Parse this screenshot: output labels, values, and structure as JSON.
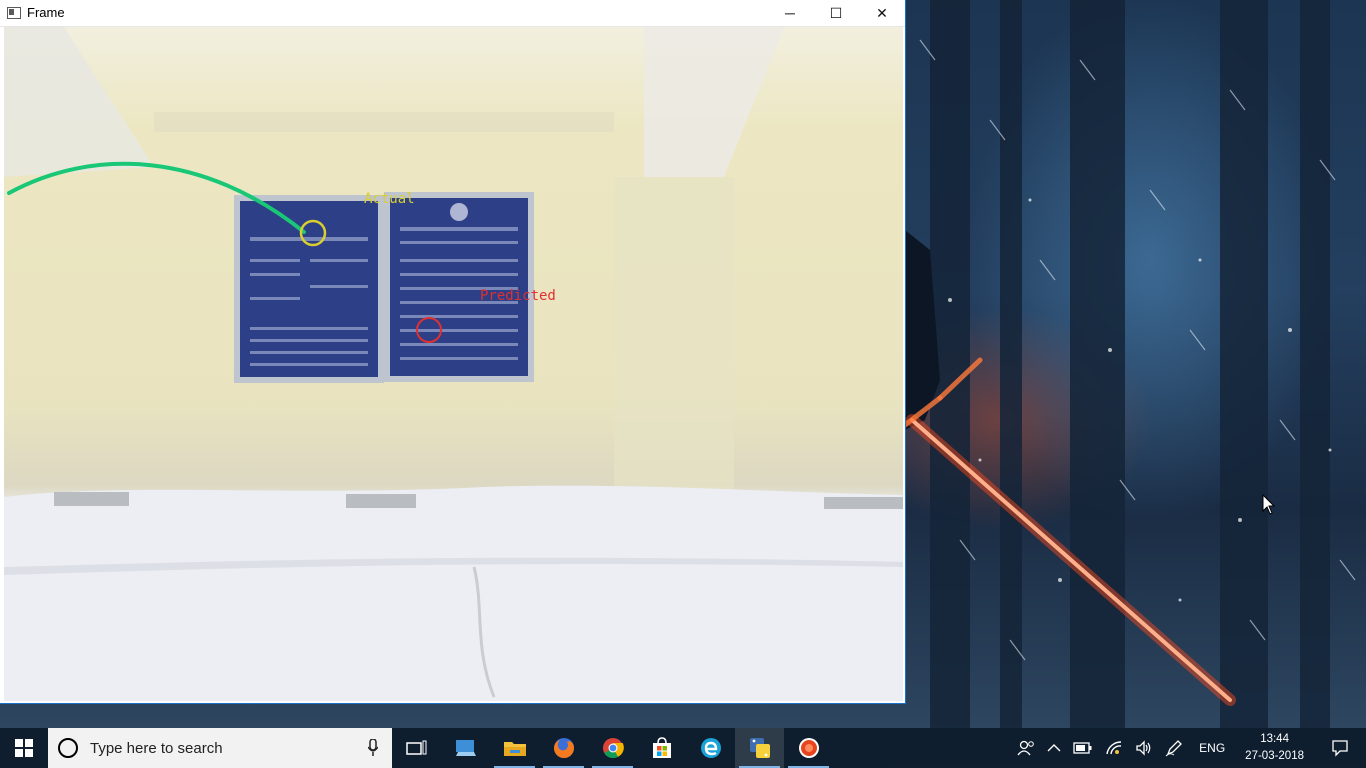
{
  "window": {
    "title": "Frame",
    "minimize_glyph": "─",
    "maximize_glyph": "☐",
    "close_glyph": "✕"
  },
  "overlay": {
    "actual_label": "Actual",
    "predicted_label": "Predicted",
    "actual_color": "#d9cf2e",
    "predicted_color": "#e03030",
    "trajectory_color": "#19c777"
  },
  "taskbar": {
    "search_placeholder": "Type here to search",
    "pinned": [
      {
        "name": "task-view-icon"
      },
      {
        "name": "pc-icon"
      },
      {
        "name": "file-explorer-icon"
      },
      {
        "name": "firefox-icon"
      },
      {
        "name": "chrome-icon"
      },
      {
        "name": "store-icon"
      },
      {
        "name": "edge-icon"
      },
      {
        "name": "python-icon"
      },
      {
        "name": "recorder-icon"
      }
    ],
    "language": "ENG",
    "time": "13:44",
    "date": "27-03-2018"
  },
  "colors": {
    "taskbar_bg": "#101e30",
    "window_border": "#1a73c9"
  }
}
